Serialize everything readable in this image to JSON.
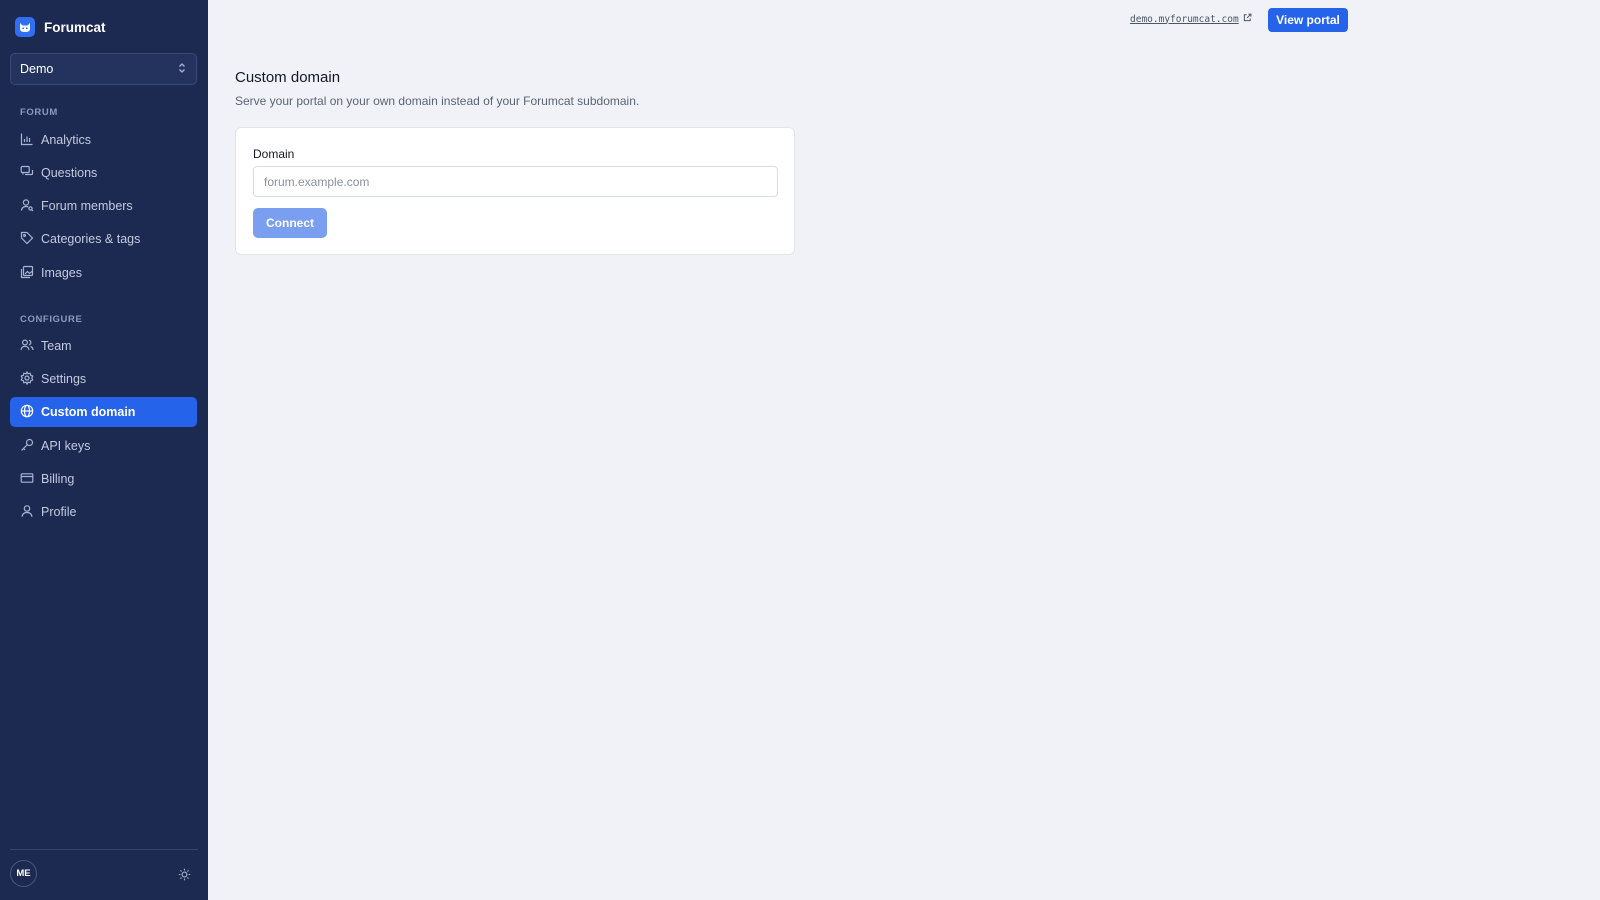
{
  "brand": {
    "name": "Forumcat",
    "logo_icon": "cat-icon",
    "accent": "#2563eb"
  },
  "workspace": {
    "selected": "Demo",
    "icon": "chevron-up-down-icon"
  },
  "sidebar": {
    "sections": [
      {
        "label": "FORUM",
        "items": [
          {
            "label": "Analytics",
            "icon": "bar-chart-icon"
          },
          {
            "label": "Questions",
            "icon": "chat-bubbles-icon"
          },
          {
            "label": "Forum members",
            "icon": "user-search-icon"
          },
          {
            "label": "Categories & tags",
            "icon": "tag-icon"
          },
          {
            "label": "Images",
            "icon": "images-icon"
          }
        ]
      },
      {
        "label": "CONFIGURE",
        "items": [
          {
            "label": "Team",
            "icon": "users-icon"
          },
          {
            "label": "Settings",
            "icon": "gear-icon"
          },
          {
            "label": "Custom domain",
            "icon": "globe-icon",
            "active": true
          },
          {
            "label": "API keys",
            "icon": "key-icon"
          },
          {
            "label": "Billing",
            "icon": "credit-card-icon"
          },
          {
            "label": "Profile",
            "icon": "user-icon"
          }
        ]
      }
    ],
    "footer": {
      "avatar_initials": "ME",
      "theme_icon": "sun-icon"
    }
  },
  "topbar": {
    "portal_url": "demo.myforumcat.com",
    "portal_url_icon": "external-link-icon",
    "view_portal_label": "View portal"
  },
  "main": {
    "title": "Custom domain",
    "subtitle": "Serve your portal on your own domain instead of your Forumcat subdomain.",
    "form": {
      "domain_label": "Domain",
      "domain_value": "",
      "domain_placeholder": "forum.example.com",
      "connect_label": "Connect",
      "connect_disabled": true
    }
  }
}
